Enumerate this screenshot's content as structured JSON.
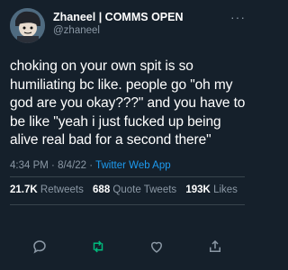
{
  "tweet": {
    "author": {
      "display_name": "Zhaneel | COMMS OPEN",
      "handle": "@zhaneel"
    },
    "text": "choking on your own spit is so humiliating bc like. people go \"oh my god are you okay???\" and you have to be like \"yeah i just fucked up being alive real bad for a second there\"",
    "time": "4:34 PM",
    "separator": "·",
    "date": "8/4/22",
    "source": "Twitter Web App",
    "stats": {
      "retweets_count": "21.7K",
      "retweets_label": "Retweets",
      "quotes_count": "688",
      "quotes_label": "Quote Tweets",
      "likes_count": "193K",
      "likes_label": "Likes"
    }
  },
  "actions": [
    "reply-icon",
    "retweet-icon",
    "like-icon",
    "share-icon"
  ],
  "colors": {
    "background": "#15202b",
    "text": "#ffffff",
    "secondary": "#8b98a5",
    "accent": "#1d9bf0",
    "retweet_green": "#00ba7c",
    "divider": "#38444d"
  }
}
